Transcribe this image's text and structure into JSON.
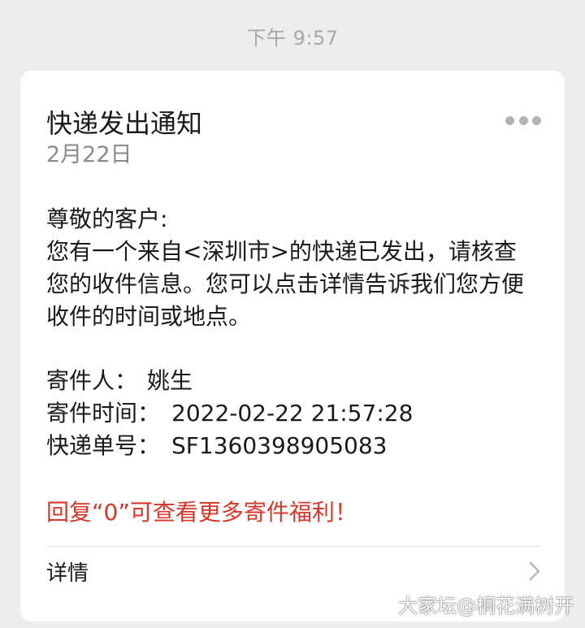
{
  "timestamp": "下午 9:57",
  "card": {
    "title": "快递发出通知",
    "date": "2月22日",
    "greeting": "尊敬的客户:",
    "message": "您有一个来自<深圳市>的快递已发出，请核查您的收件信息。您可以点击详情告诉我们您方便收件的时间或地点。",
    "info": {
      "sender_label": "寄件人：",
      "sender_value": "姚生",
      "time_label": "寄件时间：",
      "time_value": "2022-02-22 21:57:28",
      "tracking_label": "快递单号：",
      "tracking_value": "SF1360398905083"
    },
    "promo": "回复“0”可查看更多寄件福利！",
    "details_label": "详情",
    "more_icon": "ellipsis-icon",
    "chevron_icon": "chevron-right-icon"
  },
  "watermark": "大家坛@桐花满树开",
  "colors": {
    "background": "#ededed",
    "card": "#ffffff",
    "text": "#1a1a1a",
    "muted": "#8a8a8a",
    "promo": "#d7372b"
  }
}
